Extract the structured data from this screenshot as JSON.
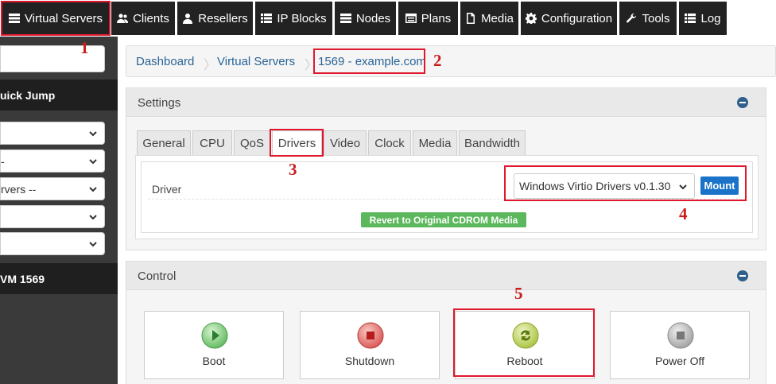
{
  "nav": {
    "items": [
      {
        "label": "Virtual Servers",
        "icon": "server-list-icon"
      },
      {
        "label": "Clients",
        "icon": "users-icon"
      },
      {
        "label": "Resellers",
        "icon": "user-icon"
      },
      {
        "label": "IP Blocks",
        "icon": "list-icon"
      },
      {
        "label": "Nodes",
        "icon": "server-icon"
      },
      {
        "label": "Plans",
        "icon": "table-icon"
      },
      {
        "label": "Media",
        "icon": "file-icon"
      },
      {
        "label": "Configuration",
        "icon": "gear-icon"
      },
      {
        "label": "Tools",
        "icon": "wrench-icon"
      },
      {
        "label": "Log",
        "icon": "list-icon"
      }
    ]
  },
  "sidebar": {
    "quick_jump_label": "uick Jump",
    "selects": [
      "",
      "-",
      "rvers --",
      "",
      ""
    ],
    "vm_label": "VM 1569"
  },
  "breadcrumb": {
    "items": [
      "Dashboard",
      "Virtual Servers",
      "1569 - example.com"
    ]
  },
  "settings": {
    "title": "Settings",
    "tabs": [
      "General",
      "CPU",
      "QoS",
      "Drivers",
      "Video",
      "Clock",
      "Media",
      "Bandwidth"
    ],
    "active_tab": "Drivers",
    "driver_label": "Driver",
    "driver_value": "Windows Virtio Drivers v0.1.30",
    "mount_label": "Mount",
    "revert_label": "Revert to Original CDROM Media"
  },
  "control": {
    "title": "Control",
    "buttons": [
      {
        "label": "Boot",
        "icon": "play-icon",
        "color": "#5cb85c"
      },
      {
        "label": "Shutdown",
        "icon": "stop-icon",
        "color": "#d9534f"
      },
      {
        "label": "Reboot",
        "icon": "refresh-icon",
        "color": "#a6c23a"
      },
      {
        "label": "Power Off",
        "icon": "square-icon",
        "color": "#9e9e9e"
      }
    ]
  },
  "annotations": [
    "1",
    "2",
    "3",
    "4",
    "5"
  ],
  "colors": {
    "nav_bg": "#222222",
    "sidebar_bg": "#3a3a3a",
    "link": "#2a6496",
    "highlight": "#e0182d",
    "mount_button": "#1a73c9",
    "revert_button": "#5cb85c"
  }
}
